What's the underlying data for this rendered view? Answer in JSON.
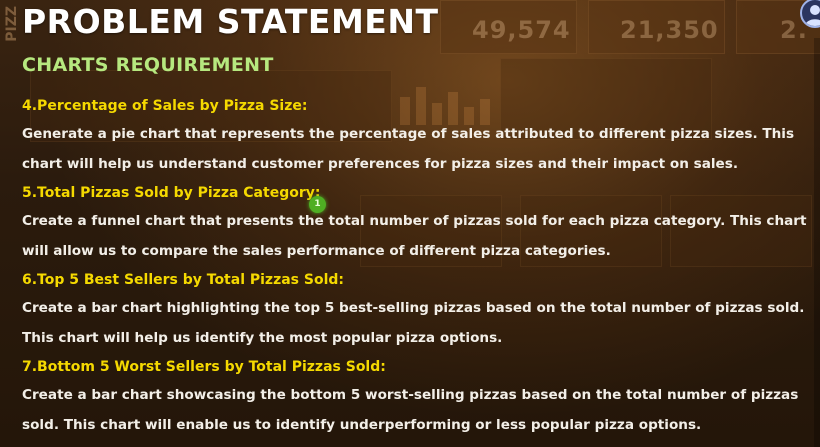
{
  "slide": {
    "title": "PROBLEM STATEMENT",
    "subtitle": "CHARTS REQUIREMENT",
    "sections": [
      {
        "heading": "4.Percentage of Sales by Pizza Size:",
        "lines": [
          "Generate a pie chart that represents the percentage of sales attributed to different pizza sizes. This",
          "chart will help us understand customer preferences for pizza sizes and their impact on sales."
        ]
      },
      {
        "heading": "5.Total Pizzas Sold by Pizza Category:",
        "lines": [
          "Create a funnel chart that presents the total number of pizzas sold for each pizza category. This chart",
          "will allow us to compare the sales performance of different pizza categories."
        ]
      },
      {
        "heading": "6.Top 5 Best Sellers by Total Pizzas Sold:",
        "lines": [
          "Create a bar chart highlighting the top 5 best-selling pizzas based on the total number of pizzas sold.",
          "This chart will help us identify the most popular pizza options."
        ]
      },
      {
        "heading": "7.Bottom 5 Worst Sellers by Total Pizzas Sold:",
        "lines": [
          "Create a bar chart showcasing the bottom 5 worst-selling pizzas based on the total number of pizzas",
          "sold. This chart will enable us to identify underperforming or less popular pizza options."
        ]
      }
    ]
  },
  "background_dashboard": {
    "kpi_values": [
      "49,574",
      "21,350",
      "2."
    ],
    "side_label": "PIZZ"
  },
  "colors": {
    "title": "#ffffff",
    "subtitle": "#b6e87f",
    "heading": "#f5d900",
    "body": "#f3efe8",
    "cursor": "#4fae23"
  },
  "icons": {
    "cursor": "pointer-dot-icon",
    "avatar": "presenter-avatar-icon"
  }
}
